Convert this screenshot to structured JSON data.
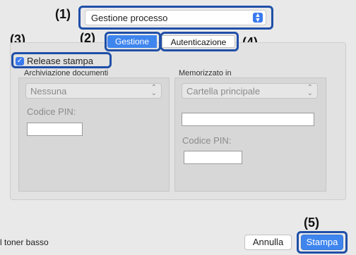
{
  "callouts": [
    "(1)",
    "(2)",
    "(3)",
    "(4)",
    "(5)"
  ],
  "popup": {
    "value": "Gestione processo"
  },
  "tabs": [
    {
      "label": "Gestione",
      "active": true
    },
    {
      "label": "Autenticazione",
      "active": false
    }
  ],
  "release": {
    "label": "Release stampa",
    "checked": true
  },
  "left_section": {
    "title": "Archiviazione documenti",
    "select_value": "Nessuna",
    "pin_label": "Codice PIN:"
  },
  "right_section": {
    "title": "Memorizzato in",
    "select_value": "Cartella principale",
    "pin_label": "Codice PIN:"
  },
  "footer": {
    "status_text": "l toner basso",
    "cancel_label": "Annulla",
    "print_label": "Stampa"
  },
  "colors": {
    "accent": "#3f85ee",
    "callout_frame": "#1f4fa8"
  }
}
